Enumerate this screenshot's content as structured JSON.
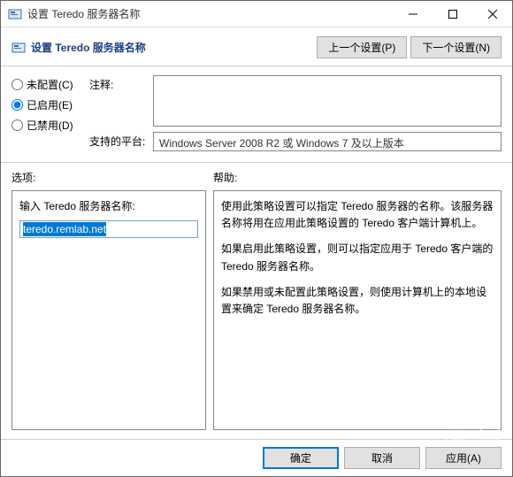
{
  "window": {
    "title": "设置 Teredo 服务器名称"
  },
  "header": {
    "title": "设置 Teredo 服务器名称",
    "prev": "上一个设置(P)",
    "next": "下一个设置(N)"
  },
  "radios": {
    "unconfigured": "未配置(C)",
    "enabled": "已启用(E)",
    "disabled": "已禁用(D)",
    "selected": "enabled"
  },
  "comment": {
    "label": "注释:"
  },
  "platform": {
    "label": "支持的平台:",
    "value": "Windows Server 2008 R2 或 Windows 7 及以上版本"
  },
  "columns": {
    "options": "选项:",
    "help": "帮助:"
  },
  "options": {
    "input_label": "输入 Teredo 服务器名称:",
    "value": "teredo.remlab.net"
  },
  "help": {
    "p1": "使用此策略设置可以指定 Teredo 服务器的名称。该服务器名称将用在应用此策略设置的 Teredo 客户端计算机上。",
    "p2": "如果启用此策略设置，则可以指定应用于 Teredo 客户端的 Teredo 服务器名称。",
    "p3": "如果禁用或未配置此策略设置，则使用计算机上的本地设置来确定 Teredo 服务器名称。"
  },
  "footer": {
    "ok": "确定",
    "cancel": "取消",
    "apply": "应用(A)"
  },
  "watermark": "九游"
}
